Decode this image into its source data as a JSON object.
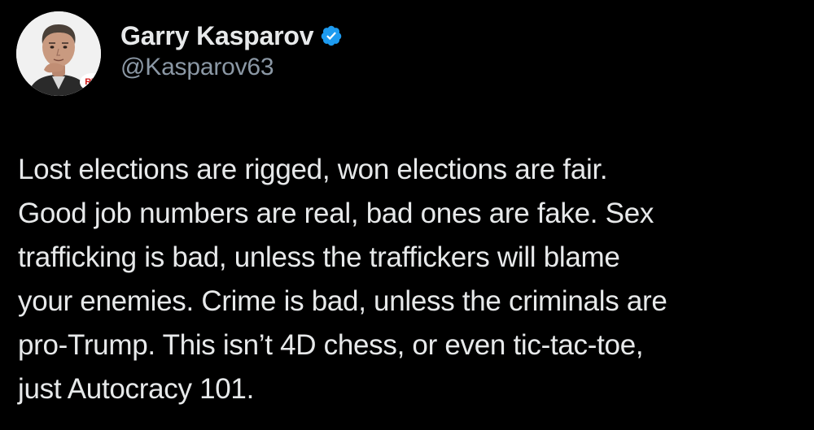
{
  "author": {
    "display_name": "Garry Kasparov",
    "handle": "@Kasparov63",
    "verified_icon": "verified-badge-icon",
    "avatar_badge_text": "RDI"
  },
  "tweet": {
    "text": "Lost elections are rigged, won elections are fair.\nGood job numbers are real, bad ones are fake. Sex\ntrafficking is bad, unless the traffickers will blame\nyour enemies. Crime is bad, unless the criminals are\npro-Trump. This isn’t 4D chess, or even tic-tac-toe,\njust Autocracy 101."
  },
  "colors": {
    "background": "#000000",
    "text": "#e7e9ea",
    "secondary_text": "#8b98a5",
    "verified_blue": "#1d9bf0"
  }
}
